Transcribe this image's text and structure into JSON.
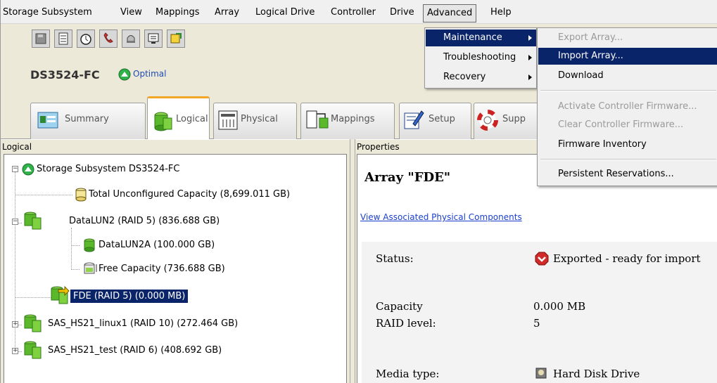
{
  "menubar": {
    "items": [
      "Storage Subsystem",
      "View",
      "Mappings",
      "Array",
      "Logical Drive",
      "Controller",
      "Drive",
      "Advanced",
      "Help"
    ],
    "active": "Advanced"
  },
  "toolbar": {
    "buttons": [
      "disk-icon",
      "list-icon",
      "clock-icon",
      "phone-icon",
      "bell-icon",
      "monitor-icon",
      "yellow-drive-icon"
    ]
  },
  "subsystem": {
    "name": "DS3524-FC",
    "status": "Optimal"
  },
  "tabs": [
    {
      "label": "Summary"
    },
    {
      "label": "Logical"
    },
    {
      "label": "Physical"
    },
    {
      "label": "Mappings"
    },
    {
      "label": "Setup"
    },
    {
      "label": "Supp"
    }
  ],
  "active_tab": "Logical",
  "left_panel": {
    "header": "Logical",
    "tree": [
      {
        "label": "Storage Subsystem DS3524-FC"
      },
      {
        "label": "Total Unconfigured Capacity (8,699.011 GB)"
      },
      {
        "label": "DataLUN2 (RAID 5) (836.688 GB)"
      },
      {
        "label": "DataLUN2A (100.000 GB)"
      },
      {
        "label": "Free Capacity (736.688 GB)"
      },
      {
        "label": "FDE (RAID 5) (0.000 MB)"
      },
      {
        "label": "SAS_HS21_linux1 (RAID 10) (272.464 GB)"
      },
      {
        "label": "SAS_HS21_test (RAID 6) (408.692 GB)"
      }
    ],
    "selected": "FDE (RAID 5) (0.000 MB)"
  },
  "right_panel": {
    "header": "Properties",
    "title": "Array \"FDE\"",
    "link": "View Associated Physical Components",
    "rows": [
      {
        "label": "Status:",
        "value": "Exported - ready for import"
      },
      {
        "label": "Capacity",
        "value": "0.000 MB"
      },
      {
        "label": "RAID level:",
        "value": "5"
      },
      {
        "label": "Media type:",
        "value": "Hard Disk Drive"
      }
    ]
  },
  "advanced_menu": {
    "items": [
      {
        "label": "Maintenance"
      },
      {
        "label": "Troubleshooting"
      },
      {
        "label": "Recovery"
      }
    ],
    "highlighted": "Maintenance"
  },
  "maintenance_submenu": {
    "items": [
      {
        "label": "Export Array...",
        "enabled": false
      },
      {
        "label": "Import Array...",
        "enabled": true
      },
      {
        "label": "Download",
        "enabled": true
      },
      {
        "label": "Activate Controller Firmware...",
        "enabled": false
      },
      {
        "label": "Clear Controller Firmware...",
        "enabled": false
      },
      {
        "label": "Firmware Inventory",
        "enabled": true
      },
      {
        "label": "Persistent Reservations...",
        "enabled": true
      }
    ],
    "highlighted": "Import Array..."
  },
  "colors": {
    "selection": "#0a246a",
    "tab_accent": "#f2a526",
    "link": "#1a3fcf",
    "optimal_green": "#2fb24a",
    "exported_red": "#d12a2a"
  }
}
